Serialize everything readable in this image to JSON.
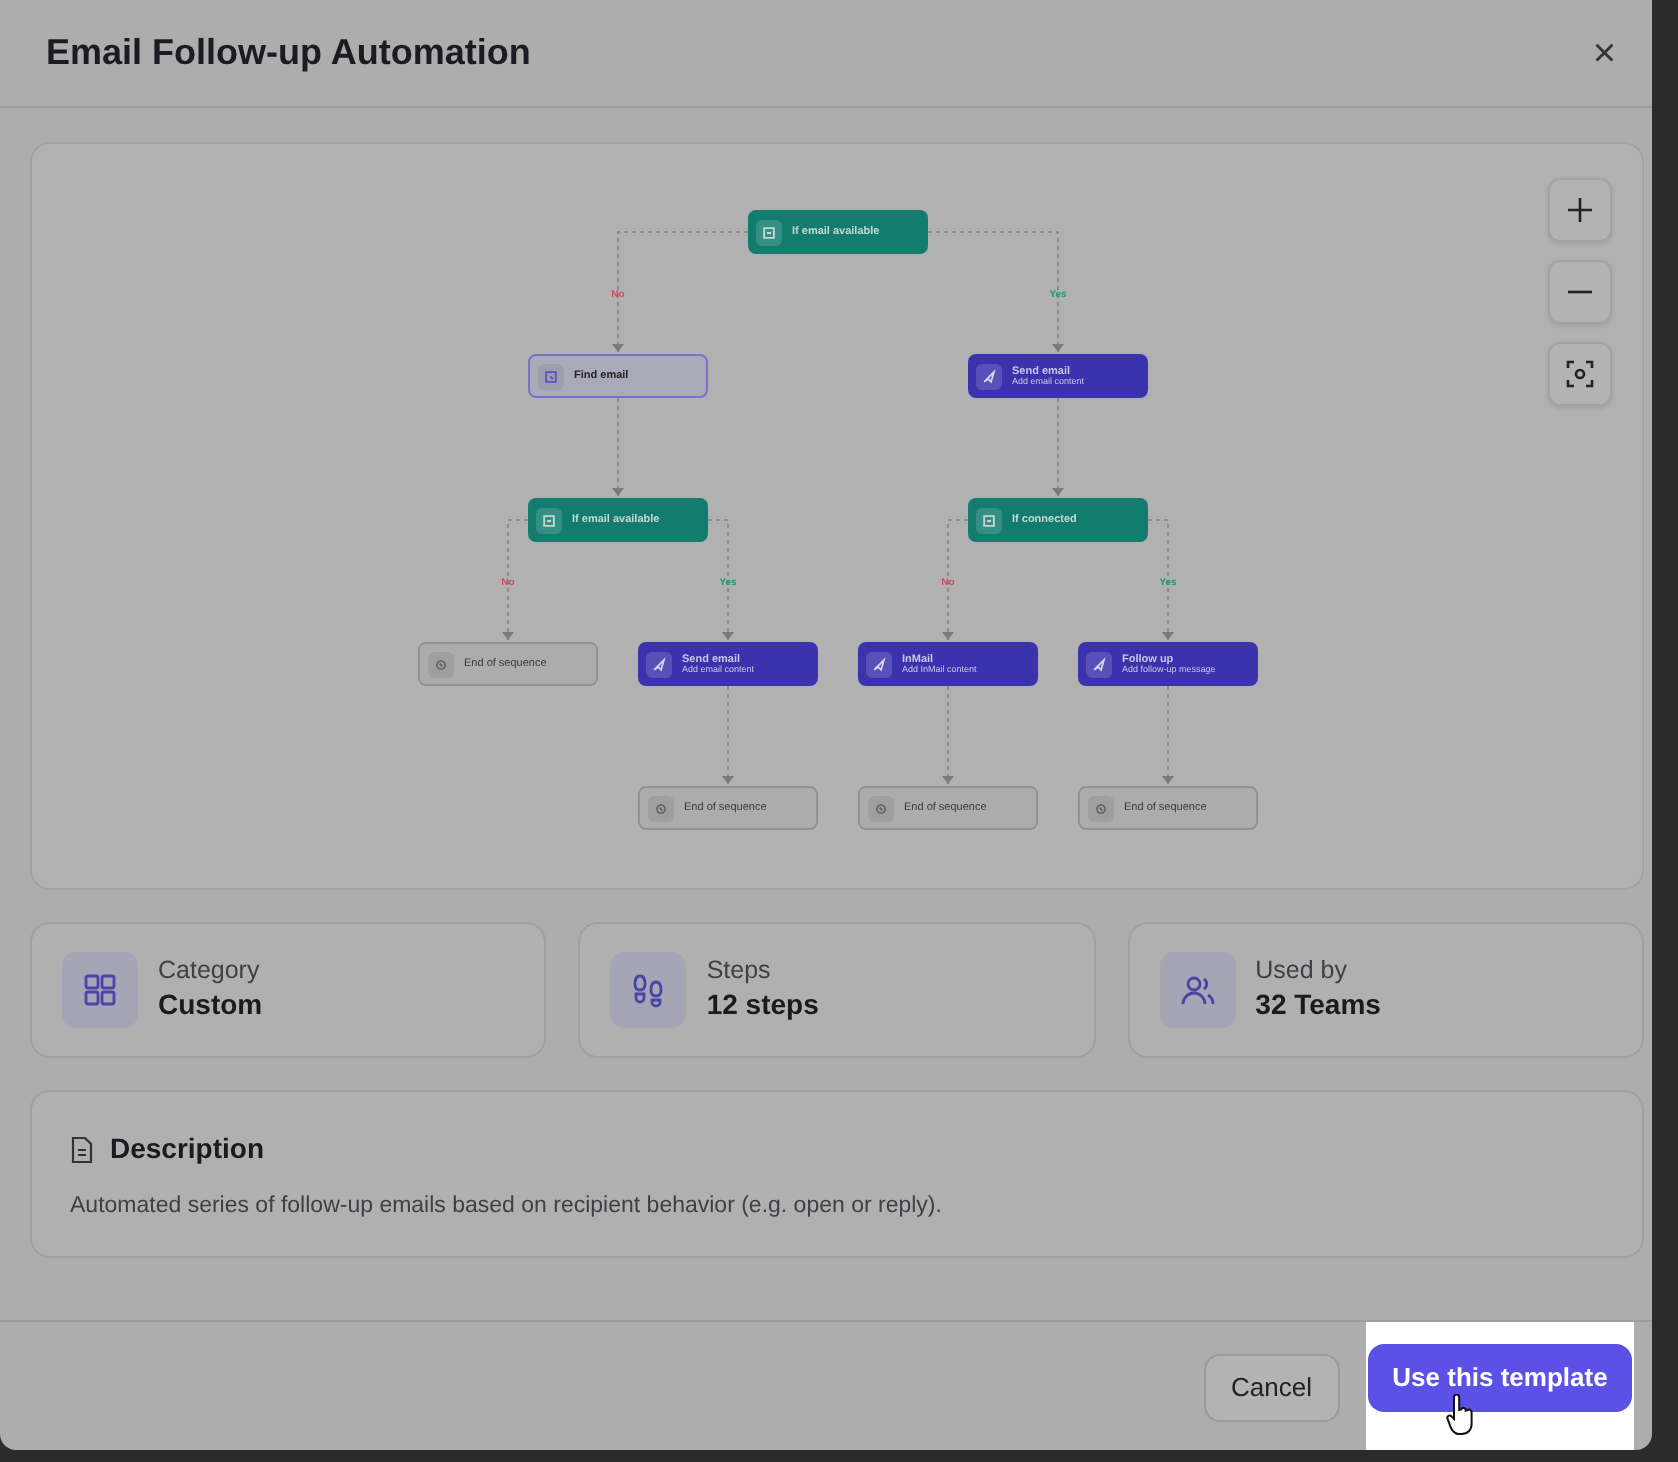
{
  "dialog": {
    "title": "Email Follow-up Automation",
    "close": "×"
  },
  "flow": {
    "kind": "condition",
    "title": "If email available",
    "children": [
      {
        "kind": "lookup",
        "title": "Find email",
        "branch": {
          "label": "No",
          "color": "#d64a5a"
        },
        "children": [
          {
            "kind": "condition",
            "title": "If email available",
            "children": [
              {
                "kind": "end",
                "title": "End of sequence",
                "branch": {
                  "label": "No",
                  "color": "#d64a5a"
                }
              },
              {
                "kind": "action",
                "title": "Send email",
                "subtitle": "Add email content",
                "branch": {
                  "label": "Yes",
                  "color": "#1f9a6a"
                },
                "children": [
                  {
                    "kind": "end",
                    "title": "End of sequence"
                  }
                ]
              }
            ]
          }
        ]
      },
      {
        "kind": "action",
        "title": "Send email",
        "subtitle": "Add email content",
        "branch": {
          "label": "Yes",
          "color": "#1f9a6a"
        },
        "children": [
          {
            "kind": "condition",
            "title": "If connected",
            "children": [
              {
                "kind": "action",
                "title": "InMail",
                "subtitle": "Add InMail content",
                "branch": {
                  "label": "No",
                  "color": "#d64a5a"
                },
                "children": [
                  {
                    "kind": "end",
                    "title": "End of sequence"
                  }
                ]
              },
              {
                "kind": "action",
                "title": "Follow up",
                "subtitle": "Add follow-up message",
                "branch": {
                  "label": "Yes",
                  "color": "#1f9a6a"
                },
                "children": [
                  {
                    "kind": "end",
                    "title": "End of sequence"
                  }
                ]
              }
            ]
          }
        ]
      }
    ]
  },
  "zoom_controls": [
    {
      "kind": "zoom-in"
    },
    {
      "kind": "zoom-out"
    },
    {
      "kind": "fit"
    }
  ],
  "stats": [
    {
      "kind": "category",
      "label": "Category",
      "value": "Custom"
    },
    {
      "kind": "steps",
      "label": "Steps",
      "value": "12 steps"
    },
    {
      "kind": "teams",
      "label": "Used by",
      "value": "32 Teams"
    }
  ],
  "description": {
    "heading": "Description",
    "text": "Automated series of follow-up emails based on recipient behavior (e.g. open or reply)."
  },
  "buttons": [
    {
      "kind": "secondary",
      "label": "Cancel"
    },
    {
      "kind": "primary",
      "label": "Use this template",
      "highlighted": true
    }
  ]
}
